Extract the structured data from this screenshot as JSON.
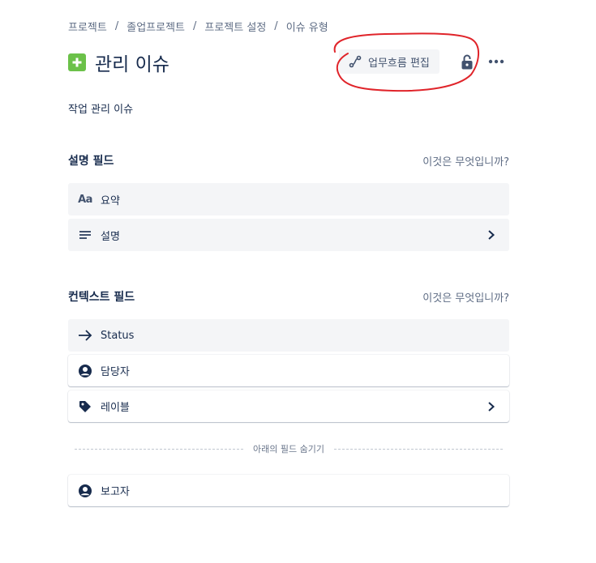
{
  "breadcrumb": {
    "items": [
      "프로젝트",
      "졸업프로젝트",
      "프로젝트 설정",
      "이슈 유형"
    ],
    "separator": "/"
  },
  "header": {
    "title": "관리 이슈",
    "icon": "plus-square-icon",
    "icon_color": "#6bc149",
    "workflow_button": "업무흐름 편집",
    "lock_icon": "unlock-icon",
    "more_icon": "more-horizontal-icon"
  },
  "description": "작업 관리 이슈",
  "description_fields": {
    "title": "설명 필드",
    "help": "이것은 무엇입니까?",
    "items": [
      {
        "label": "요약",
        "icon": "text-aa-icon"
      },
      {
        "label": "설명",
        "icon": "align-left-icon"
      }
    ]
  },
  "context_fields": {
    "title": "컨텍스트 필드",
    "help": "이것은 무엇입니까?",
    "items": [
      {
        "label": "Status",
        "icon": "arrow-right-icon"
      },
      {
        "label": "담당자",
        "icon": "person-circle-icon"
      },
      {
        "label": "레이블",
        "icon": "tag-icon"
      }
    ]
  },
  "hidden_divider": "아래의 필드 숨기기",
  "hidden_fields": {
    "items": [
      {
        "label": "보고자",
        "icon": "person-circle-icon"
      }
    ]
  },
  "colors": {
    "text": "#172b4d",
    "subtle": "#5e6c84",
    "locked_bg": "#f4f5f7",
    "annotation": "#e0242a"
  }
}
